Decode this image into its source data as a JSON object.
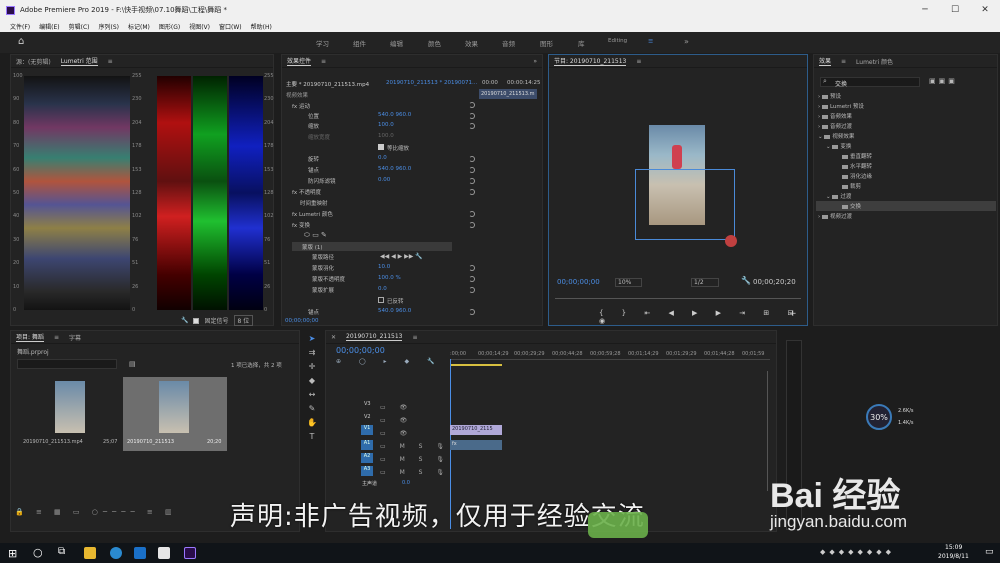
{
  "window": {
    "title": "Adobe Premiere Pro 2019 - F:\\快手视频\\07.10舞蹈\\工程\\舞蹈 *"
  },
  "menu": [
    "文件(F)",
    "编辑(E)",
    "剪辑(C)",
    "序列(S)",
    "标记(M)",
    "图形(G)",
    "视图(V)",
    "窗口(W)",
    "帮助(H)"
  ],
  "workspaces": [
    "学习",
    "组件",
    "编辑",
    "颜色",
    "效果",
    "音频",
    "图形",
    "库",
    "Editing"
  ],
  "scopes": {
    "tabs": [
      "源：(无剪辑)",
      "Lumetri 范围"
    ],
    "left_axis": [
      "100",
      "90",
      "80",
      "70",
      "60",
      "50",
      "40",
      "30",
      "20",
      "10",
      "0"
    ],
    "mid_axis": [
      "255",
      "230",
      "204",
      "178",
      "153",
      "128",
      "102",
      "76",
      "51",
      "26",
      "0"
    ],
    "right_axis": [
      "255",
      "230",
      "204",
      "178",
      "153",
      "128",
      "102",
      "76",
      "51",
      "26",
      "0"
    ],
    "clamp_label": "固定信号",
    "bits": "8 位"
  },
  "effect_controls": {
    "tab": "效果控件",
    "master": "主要 * 20190710_211513.mp4",
    "sequence": "20190710_211513 * 20190071...",
    "times": [
      "00:00",
      "00:00:14:25"
    ],
    "clip_name": "20190710_211513.m",
    "section_video": "视频效果",
    "rows": [
      {
        "name": "fx  运动",
        "val": ""
      },
      {
        "name": "位置",
        "val": "540.0     960.0"
      },
      {
        "name": "缩放",
        "val": "100.0"
      },
      {
        "name": "缩放宽度",
        "val": "100.0"
      },
      {
        "name": "等比缩放",
        "val": ""
      },
      {
        "name": "旋转",
        "val": "0.0"
      },
      {
        "name": "锚点",
        "val": "540.0     960.0"
      },
      {
        "name": "防闪烁滤镜",
        "val": "0.00"
      },
      {
        "name": "fx  不透明度",
        "val": ""
      },
      {
        "name": "时间重映射",
        "val": ""
      },
      {
        "name": "fx  Lumetri 颜色",
        "val": ""
      },
      {
        "name": "fx  变换",
        "val": ""
      }
    ],
    "mask_title": "蒙版 (1)",
    "mask_rows": [
      {
        "name": "蒙版路径",
        "val": ""
      },
      {
        "name": "蒙版羽化",
        "val": "10.0"
      },
      {
        "name": "蒙版不透明度",
        "val": "100.0 %"
      },
      {
        "name": "蒙版扩展",
        "val": "0.0"
      },
      {
        "name": "已反转",
        "val": ""
      },
      {
        "name": "锚点",
        "val": "540.0     960.0"
      }
    ],
    "time_bottom": "00;00;00;00"
  },
  "program": {
    "title": "节目: 20190710_211513",
    "timecode": "00;00;00;00",
    "zoom": "10%",
    "resolution": "1/2",
    "duration": "00;00;20;20"
  },
  "effects": {
    "tabs": [
      "效果",
      "Lumetri 颜色"
    ],
    "search": "交换",
    "tree": [
      {
        "label": "预设",
        "indent": 0,
        "sel": false
      },
      {
        "label": "Lumetri 预设",
        "indent": 0,
        "sel": false
      },
      {
        "label": "音频效果",
        "indent": 0,
        "sel": false
      },
      {
        "label": "音频过渡",
        "indent": 0,
        "sel": false
      },
      {
        "label": "视频效果",
        "indent": 0,
        "sel": false
      },
      {
        "label": "变换",
        "indent": 1,
        "sel": false
      },
      {
        "label": "垂直翻转",
        "indent": 2,
        "sel": false
      },
      {
        "label": "水平翻转",
        "indent": 2,
        "sel": false
      },
      {
        "label": "羽化边缘",
        "indent": 2,
        "sel": false
      },
      {
        "label": "裁剪",
        "indent": 2,
        "sel": false
      },
      {
        "label": "过渡",
        "indent": 1,
        "sel": false
      },
      {
        "label": "交换",
        "indent": 2,
        "sel": true
      },
      {
        "label": "视频过渡",
        "indent": 0,
        "sel": false
      }
    ]
  },
  "project": {
    "tabs": [
      "项目: 舞蹈",
      "字幕"
    ],
    "path": "舞蹈.prproj",
    "selection": "1 项已选择，共 2 项",
    "items": [
      {
        "name": "20190710_211513.mp4",
        "duration": "25;07"
      },
      {
        "name": "20190710_211513",
        "duration": "20;20"
      }
    ]
  },
  "timeline": {
    "tab": "20190710_211513",
    "timecode": "00;00;00;00",
    "ruler": [
      ":00;00",
      "00;00;14;29",
      "00;00;29;29",
      "00;00;44;28",
      "00;00;59;28",
      "00;01;14;29",
      "00;01;29;29",
      "00;01;44;28",
      "00;01;59"
    ],
    "video_tracks": [
      "V3",
      "V2",
      "V1"
    ],
    "audio_tracks": [
      "A1",
      "A2",
      "A3"
    ],
    "master": "主声道",
    "master_val": "0.0",
    "clip_v": "20190710_2115",
    "clip_a": "fx"
  },
  "perf": {
    "percent": "30%",
    "up": "2.6K/s",
    "down": "1.4K/s"
  },
  "taskbar": {
    "time": "15:09",
    "date": "2019/8/11"
  },
  "watermark": "声明:非广告视频，仅用于经验交流",
  "baidu": {
    "logo_text": "Bai 经验",
    "url": "jingyan.baidu.com"
  }
}
